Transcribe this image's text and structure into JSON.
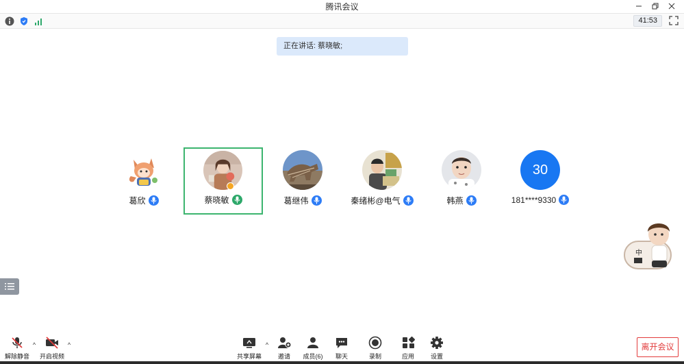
{
  "window": {
    "title": "腾讯会议"
  },
  "infobar": {
    "timer": "41:53"
  },
  "speaking_banner": {
    "text": "正在讲话: 蔡晓敏;"
  },
  "participants": [
    {
      "name": "葛欣",
      "avatar": "cartoon-fox-avatar"
    },
    {
      "name": "蔡晓敏",
      "avatar": "photo-avatar",
      "active": true
    },
    {
      "name": "葛继伟",
      "avatar": "dinosaur-photo-avatar"
    },
    {
      "name": "秦绪彬@电气",
      "avatar": "child-photo-avatar"
    },
    {
      "name": "韩燕",
      "avatar": "baby-photo-avatar"
    },
    {
      "name": "181****9330",
      "avatar_text": "30"
    }
  ],
  "assistant": {
    "label": "中"
  },
  "toolbar": {
    "unmute": "解除静音",
    "start_video": "开启视频",
    "share_screen": "共享屏幕",
    "invite": "邀请",
    "members": "成员(6)",
    "chat": "聊天",
    "record": "录制",
    "apps": "应用",
    "settings": "设置",
    "leave": "离开会议"
  },
  "colors": {
    "accent_blue": "#2d7cf6",
    "active_border": "#3bb46e",
    "leave_red": "#e23b3b",
    "banner_bg": "#dbe9fb"
  }
}
